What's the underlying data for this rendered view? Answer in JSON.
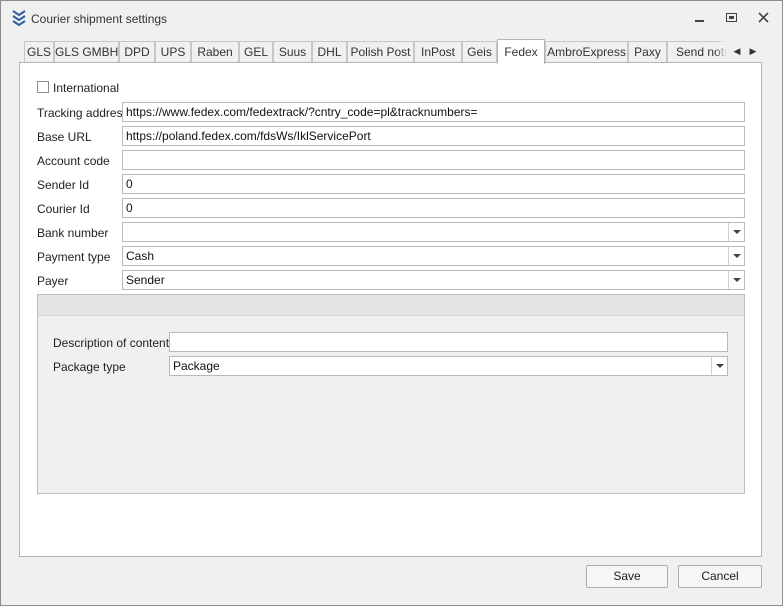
{
  "window": {
    "title": "Courier shipment settings",
    "icon": "chevron-stack-icon",
    "controls": [
      "minimize-icon",
      "maximize-icon",
      "close-icon"
    ]
  },
  "tabs": [
    {
      "label": "GLS"
    },
    {
      "label": "GLS GMBH"
    },
    {
      "label": "DPD"
    },
    {
      "label": "UPS"
    },
    {
      "label": "Raben"
    },
    {
      "label": "GEL"
    },
    {
      "label": "Suus"
    },
    {
      "label": "DHL"
    },
    {
      "label": "Polish Post"
    },
    {
      "label": "InPost"
    },
    {
      "label": "Geis"
    },
    {
      "label": "Fedex"
    },
    {
      "label": "AmbroExpress"
    },
    {
      "label": "Paxy"
    },
    {
      "label": "Send notifi"
    }
  ],
  "active_tab": "Fedex",
  "form": {
    "international": {
      "label": "International",
      "checked": false
    },
    "tracking_address": {
      "label": "Tracking address",
      "value": "https://www.fedex.com/fedextrack/?cntry_code=pl&tracknumbers="
    },
    "base_url": {
      "label": "Base URL",
      "value": "https://poland.fedex.com/fdsWs/IklServicePort"
    },
    "account_code": {
      "label": "Account code",
      "value": ""
    },
    "sender_id": {
      "label": "Sender Id",
      "value": "0"
    },
    "courier_id": {
      "label": "Courier Id",
      "value": "0"
    },
    "bank_number": {
      "label": "Bank number",
      "value": ""
    },
    "payment_type": {
      "label": "Payment type",
      "value": "Cash"
    },
    "payer": {
      "label": "Payer",
      "value": "Sender"
    }
  },
  "group": {
    "description": {
      "label": "Description of contents",
      "value": ""
    },
    "package_type": {
      "label": "Package type",
      "value": "Package"
    }
  },
  "buttons": {
    "save": "Save",
    "cancel": "Cancel"
  },
  "colors": {
    "window_bg": "#f0f0f0",
    "page_bg": "#ffffff",
    "icon_blue": "#2f5f9e"
  }
}
